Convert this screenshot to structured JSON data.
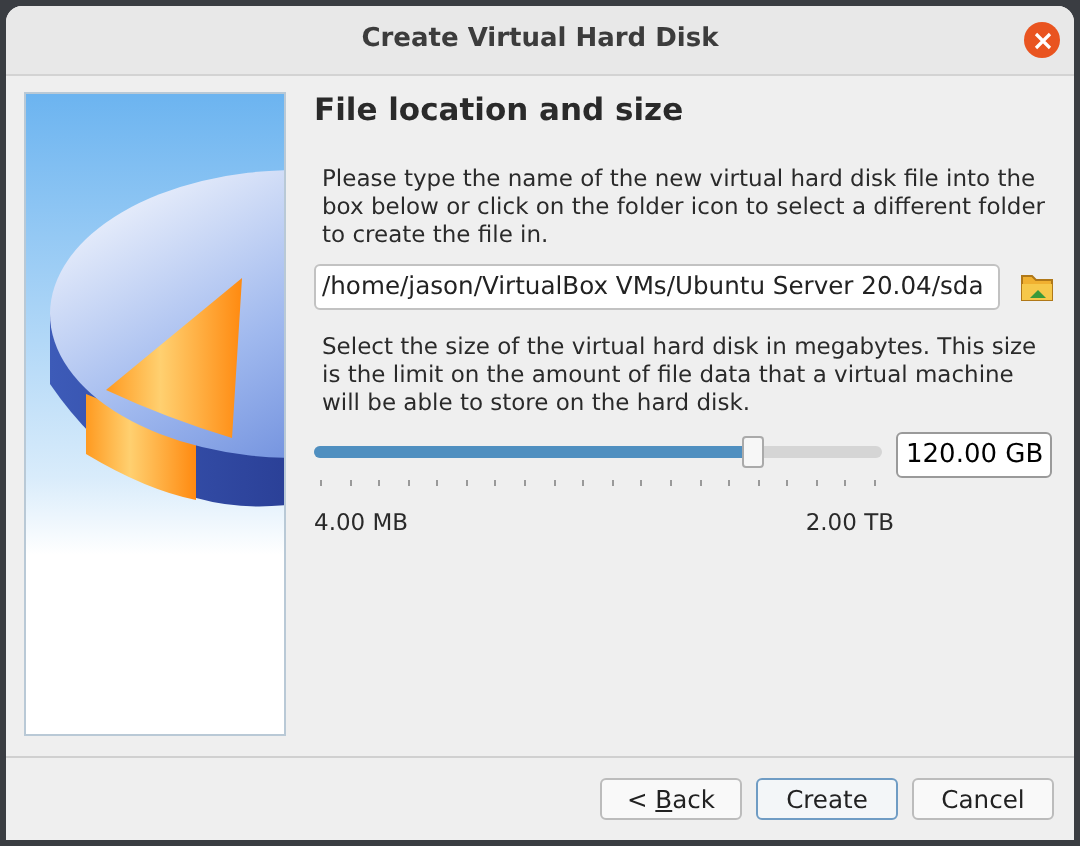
{
  "window": {
    "title": "Create Virtual Hard Disk"
  },
  "page": {
    "heading": "File location and size",
    "location_text": "Please type the name of the new virtual hard disk file into the box below or click on the folder icon to select a different folder to create the file in.",
    "location_value": "/home/jason/VirtualBox VMs/Ubuntu Server 20.04/sda",
    "size_text": "Select the size of the virtual hard disk in megabytes. This size is the limit on the amount of file data that a virtual machine will be able to store on the hard disk.",
    "size_slider": {
      "level": 0.77
    },
    "size_value": "120.00 GB",
    "min_label": "4.00 MB",
    "max_label": "2.00 TB"
  },
  "buttons": [
    {
      "label_parts": [
        {
          "text": "< ",
          "underlined": false
        },
        {
          "text": "B",
          "underlined": true
        },
        {
          "text": "ack",
          "underlined": false
        }
      ],
      "default": false
    },
    {
      "label": "Create",
      "default": true
    },
    {
      "label": "Cancel",
      "default": false
    }
  ]
}
